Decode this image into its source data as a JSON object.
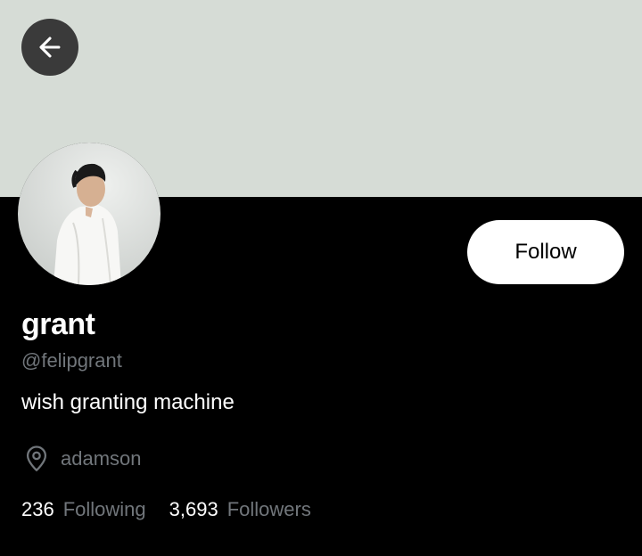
{
  "profile": {
    "display_name": "grant",
    "handle": "@felipgrant",
    "bio": "wish granting machine",
    "location": "adamson",
    "follow_label": "Follow",
    "stats": {
      "following_count": "236",
      "following_label": "Following",
      "followers_count": "3,693",
      "followers_label": "Followers"
    }
  },
  "icons": {
    "back": "arrow-left-icon",
    "location": "map-pin-icon"
  },
  "colors": {
    "banner": "#d6dcd6",
    "background": "#000000",
    "secondary_text": "#71767b",
    "back_button": "#3a3a3a",
    "follow_button": "#ffffff"
  }
}
